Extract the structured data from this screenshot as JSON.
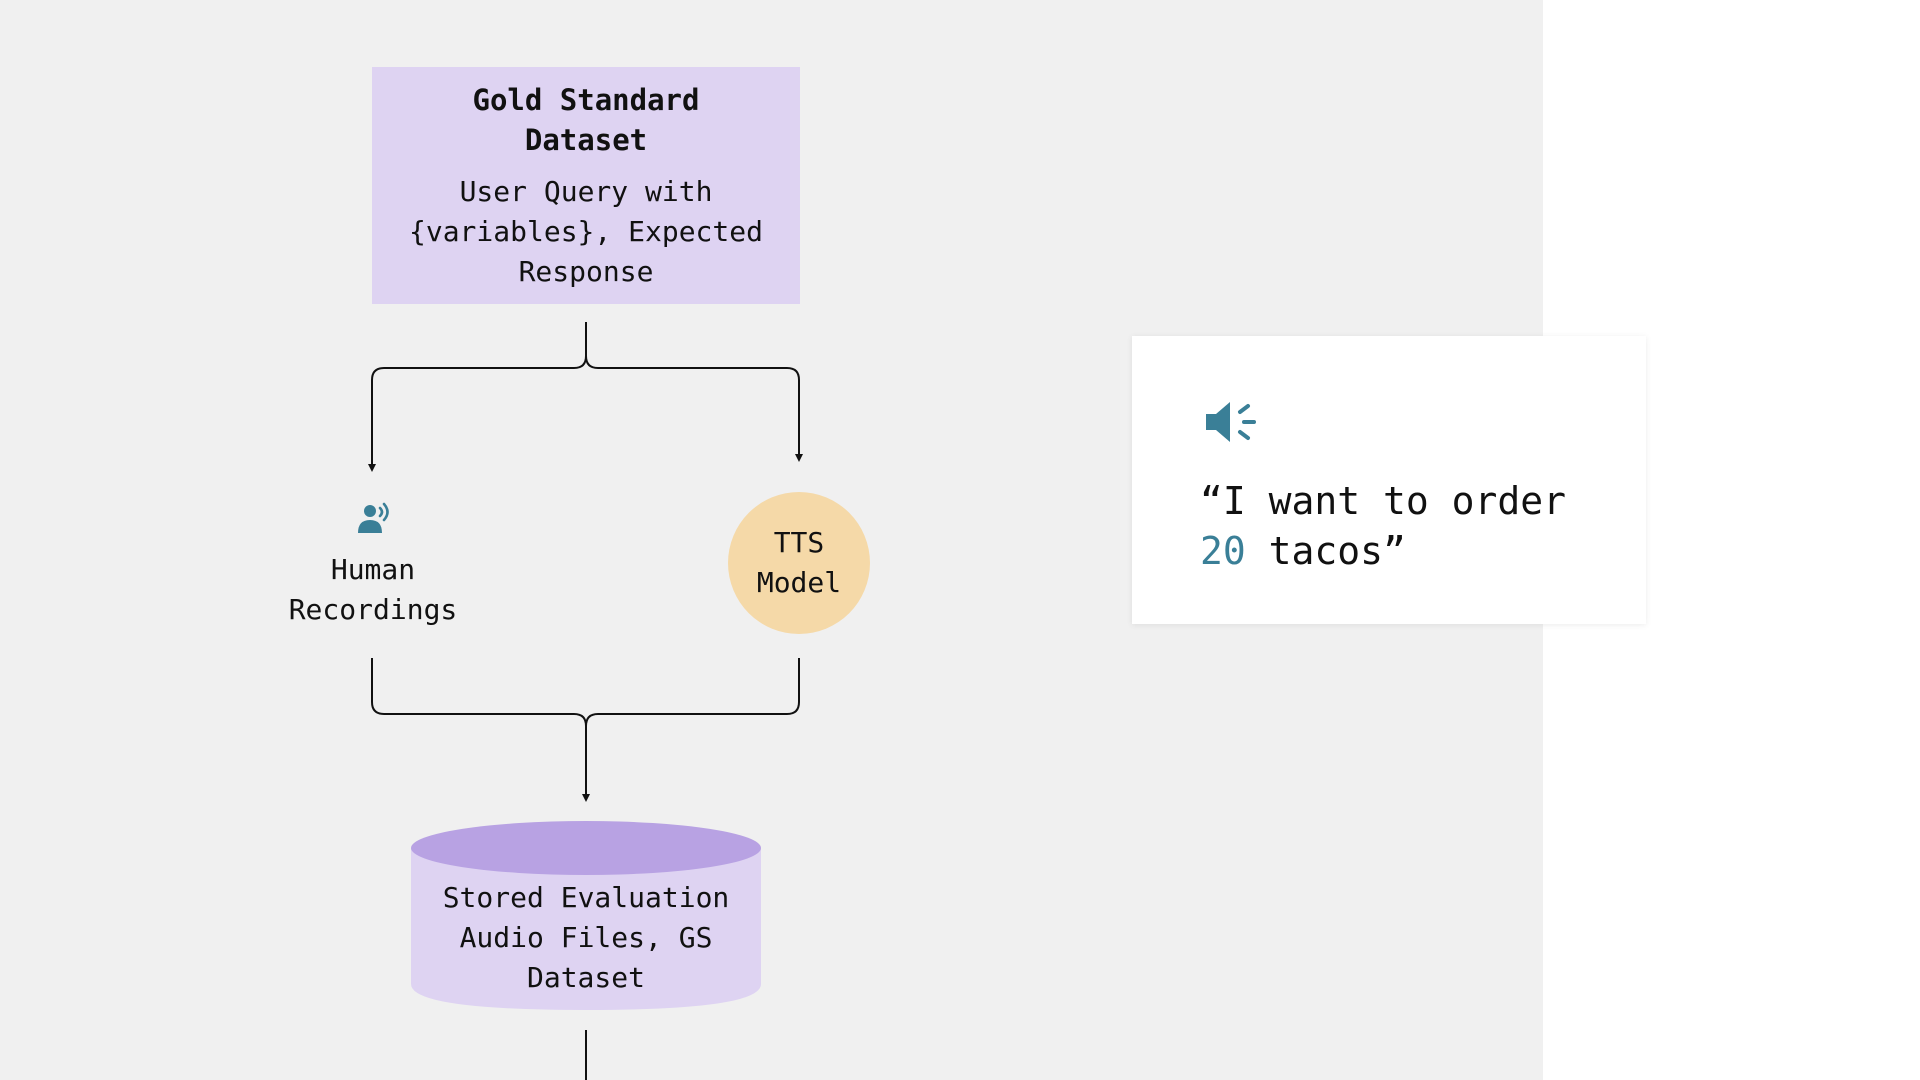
{
  "gold_standard": {
    "title": "Gold Standard Dataset",
    "description": "User Query with {variables}, Expected Response"
  },
  "human_recordings": {
    "icon": "person-speaking-icon",
    "label": "Human Recordings"
  },
  "tts_model": {
    "label": "TTS Model"
  },
  "storage": {
    "label": "Stored Evaluation Audio Files, GS Dataset"
  },
  "quote_card": {
    "icon": "speaker-icon",
    "quote_open": "“I want to order ",
    "quote_number": "20",
    "quote_close": " tacos”"
  },
  "colors": {
    "gold_standard_fill": "#ded3f2",
    "tts_fill": "#f5d9a8",
    "storage_fill": "#ded3f2",
    "storage_top": "#b8a2e3",
    "accent": "#3a7f97",
    "panel_background": "#f0f0f0"
  }
}
